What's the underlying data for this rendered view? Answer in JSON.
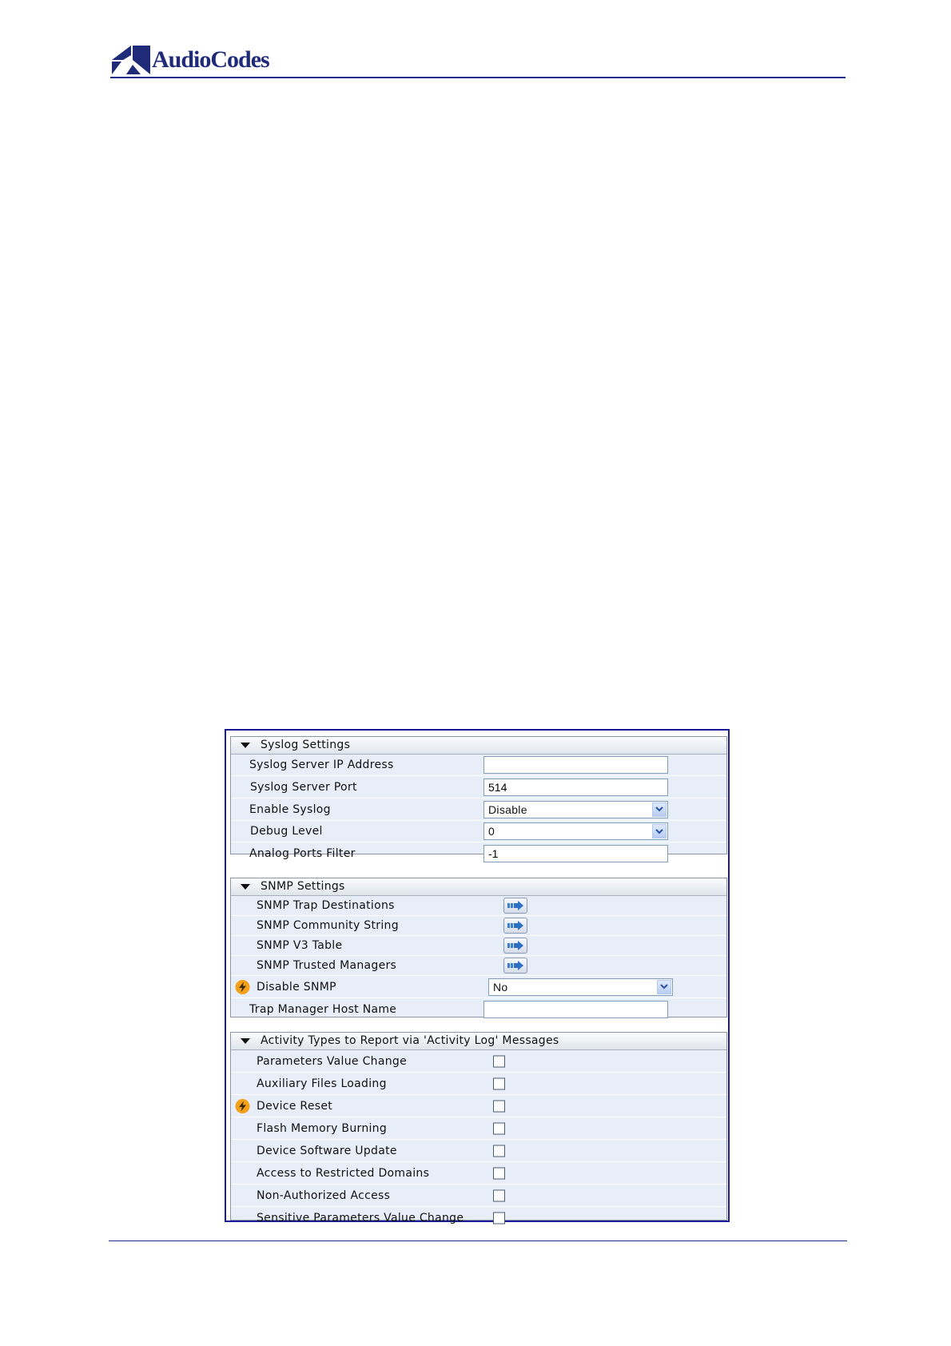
{
  "header": {
    "logo_text": "AudioCodes"
  },
  "panel": {
    "syslog": {
      "title": "Syslog Settings",
      "rows": [
        {
          "label": "Syslog Server IP Address",
          "value": ""
        },
        {
          "label": "Syslog Server Port",
          "value": "514"
        },
        {
          "label": "Enable Syslog",
          "value": "Disable"
        },
        {
          "label": "Debug Level",
          "value": "0"
        },
        {
          "label": "Analog Ports Filter",
          "value": "-1"
        }
      ]
    },
    "snmp": {
      "title": "SNMP Settings",
      "rows": [
        {
          "label": "SNMP Trap Destinations"
        },
        {
          "label": "SNMP Community String"
        },
        {
          "label": "SNMP V3 Table"
        },
        {
          "label": "SNMP Trusted Managers"
        },
        {
          "label": "Disable SNMP",
          "value": "No"
        },
        {
          "label": "Trap Manager Host Name",
          "value": ""
        }
      ]
    },
    "activity": {
      "title": "Activity Types to Report via 'Activity Log' Messages",
      "rows": [
        {
          "label": "Parameters Value Change",
          "checked": false
        },
        {
          "label": "Auxiliary Files Loading",
          "checked": false
        },
        {
          "label": "Device Reset",
          "checked": false
        },
        {
          "label": "Flash Memory Burning",
          "checked": false
        },
        {
          "label": "Device Software Update",
          "checked": false
        },
        {
          "label": "Access to Restricted Domains",
          "checked": false
        },
        {
          "label": "Non-Authorized Access",
          "checked": false
        },
        {
          "label": "Sensitive Parameters Value Change",
          "checked": false
        }
      ]
    }
  },
  "icons": {
    "expand": "triangle-down-icon",
    "dropdown": "chevron-down-icon",
    "navigate": "arrow-right-icon",
    "reset_required": "lightning-icon"
  },
  "colors": {
    "rule": "#1e2a8c",
    "panel_border": "#1b1b9a",
    "group_background": "#e7eef8",
    "logo_text": "#1f2a78",
    "bolt": "#f4a11a"
  }
}
